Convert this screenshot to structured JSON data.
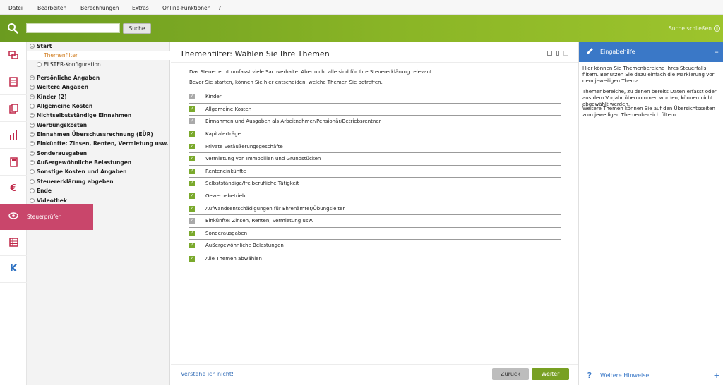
{
  "menu": {
    "items": [
      "Datei",
      "Bearbeiten",
      "Berechnungen",
      "Extras",
      "Online-Funktionen",
      "?"
    ]
  },
  "toolbar": {
    "search_value": "",
    "search_button": "Suche",
    "close_search": "Suche schließen"
  },
  "sidebar_icons": [
    "chat-icon",
    "form-icon",
    "documents-icon",
    "chart-icon",
    "calculator-icon",
    "euro-icon",
    "eye-icon",
    "grid-icon",
    "k-logo-icon"
  ],
  "tree": {
    "items": [
      {
        "label": "Start",
        "expander": "−",
        "kind": "root"
      },
      {
        "label": "Themenfilter",
        "kind": "active"
      },
      {
        "label": "ELSTER-Konfiguration",
        "kind": "sub"
      },
      {
        "label": "Persönliche Angaben",
        "expander": "+"
      },
      {
        "label": "Weitere Angaben",
        "expander": "+"
      },
      {
        "label": "Kinder (2)",
        "expander": "+"
      },
      {
        "label": "Allgemeine Kosten",
        "expander": ""
      },
      {
        "label": "Nichtselbstständige Einnahmen",
        "expander": "+"
      },
      {
        "label": "Werbungskosten",
        "expander": "+"
      },
      {
        "label": "Einnahmen Überschussrechnung (EÜR)",
        "expander": "+"
      },
      {
        "label": "Einkünfte: Zinsen, Renten, Vermietung usw.",
        "expander": "+"
      },
      {
        "label": "Sonderausgaben",
        "expander": "+"
      },
      {
        "label": "Außergewöhnliche Belastungen",
        "expander": "+"
      },
      {
        "label": "Sonstige Kosten und Angaben",
        "expander": "+"
      },
      {
        "label": "Steuererklärung abgeben",
        "expander": "+"
      },
      {
        "label": "Ende",
        "expander": "+"
      },
      {
        "label": "Videothek",
        "expander": ""
      }
    ],
    "steuerpruefer": "Steuerprüfer"
  },
  "main": {
    "title": "Themenfilter: Wählen Sie Ihre Themen",
    "intro1": "Das Steuerrecht umfasst viele Sachverhalte. Aber nicht alle sind für Ihre Steuererklärung relevant.",
    "intro2": "Bevor Sie starten, können Sie hier entscheiden, welche Themen Sie betreffen.",
    "topics": [
      {
        "label": "Kinder",
        "state": "locked"
      },
      {
        "label": "Allgemeine Kosten",
        "state": "checked"
      },
      {
        "label": "Einnahmen und Ausgaben als Arbeitnehmer/Pensionär/Betriebsrentner",
        "state": "locked"
      },
      {
        "label": "Kapitalerträge",
        "state": "checked"
      },
      {
        "label": "Private Veräußerungsgeschäfte",
        "state": "checked"
      },
      {
        "label": "Vermietung von Immobilien und Grundstücken",
        "state": "checked"
      },
      {
        "label": "Renteneinkünfte",
        "state": "checked"
      },
      {
        "label": "Selbstständige/freiberufliche Tätigkeit",
        "state": "checked"
      },
      {
        "label": "Gewerbebetrieb",
        "state": "checked"
      },
      {
        "label": "Aufwandsentschädigungen für Ehrenämter/Übungsleiter",
        "state": "checked"
      },
      {
        "label": "Einkünfte: Zinsen, Renten, Vermietung usw.",
        "state": "locked"
      },
      {
        "label": "Sonderausgaben",
        "state": "checked"
      },
      {
        "label": "Außergewöhnliche Belastungen",
        "state": "checked"
      },
      {
        "label": "Alle Themen abwählen",
        "state": "checked"
      }
    ],
    "help_link": "Verstehe ich nicht!",
    "back_label": "Zurück",
    "next_label": "Weiter"
  },
  "help": {
    "title": "Eingabehilfe",
    "p1": "Hier können Sie Themenbereiche Ihres Steuerfalls filtern. Benutzen Sie dazu einfach die Markierung vor dem jeweiligen Thema.",
    "p2": "Themenbereiche, zu denen bereits Daten erfasst oder aus dem Vorjahr übernommen wurden, können nicht abgewählt werden.",
    "p3": "Weitere Themen können Sie auf den Übersichtsseiten zum jeweiligen Themenbereich filtern.",
    "more": "Weitere Hinweise"
  },
  "colors": {
    "brand_green": "#8ab526",
    "accent_pink": "#c9466b",
    "help_blue": "#3a78c7",
    "active_orange": "#d07a1a"
  }
}
